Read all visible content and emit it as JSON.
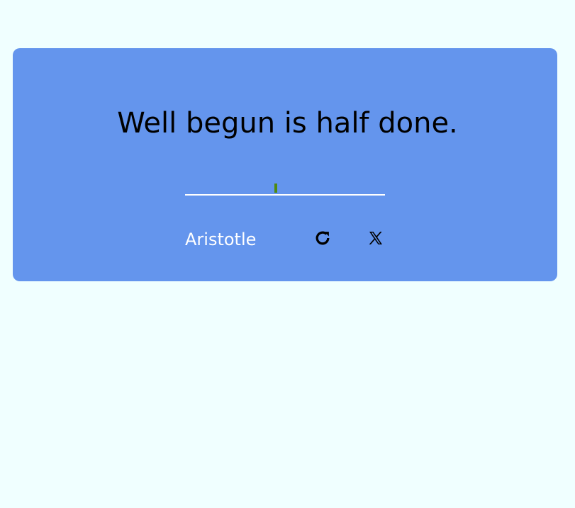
{
  "quote": {
    "text": "Well begun is half done.",
    "author": "Aristotle"
  },
  "actions": {
    "new_quote_icon": "refresh-icon",
    "tweet_icon": "x-logo-icon"
  },
  "colors": {
    "background": "#f0ffff",
    "card": "#6495ed",
    "accent": "#4f8a10",
    "author_text": "#ffffff"
  }
}
